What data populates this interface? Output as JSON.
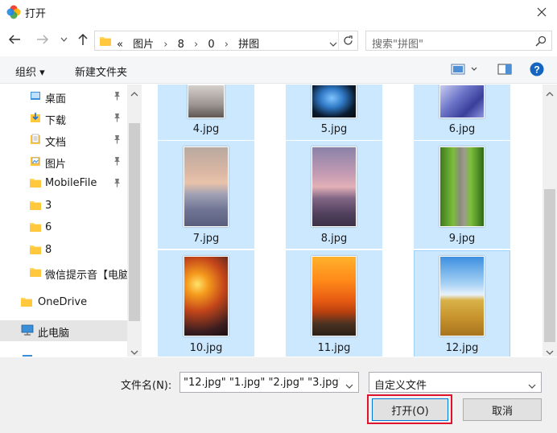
{
  "window": {
    "title": "打开",
    "colors": {
      "selection": "#cce8ff",
      "accent": "#0078d7",
      "highlight_box": "#e0132e"
    }
  },
  "address": {
    "crumbs": [
      "«",
      "图片",
      "8",
      "0",
      "拼图"
    ],
    "separator": "›"
  },
  "search": {
    "placeholder": "搜索\"拼图\""
  },
  "toolbar": {
    "organize": "组织 ▾",
    "new_folder": "新建文件夹"
  },
  "sidebar": {
    "items": [
      {
        "label": "桌面",
        "icon": "desktop-folder-icon",
        "pinned": true
      },
      {
        "label": "下载",
        "icon": "download-folder-icon",
        "pinned": true
      },
      {
        "label": "文档",
        "icon": "documents-folder-icon",
        "pinned": true
      },
      {
        "label": "图片",
        "icon": "pictures-folder-icon",
        "pinned": true
      },
      {
        "label": "MobileFile",
        "icon": "folder-icon",
        "pinned": true
      },
      {
        "label": "3",
        "icon": "folder-icon",
        "pinned": false
      },
      {
        "label": "6",
        "icon": "folder-icon",
        "pinned": false
      },
      {
        "label": "8",
        "icon": "folder-icon",
        "pinned": false
      },
      {
        "label": "微信提示音【电脑",
        "icon": "folder-icon",
        "pinned": false
      },
      {
        "label": "OneDrive",
        "icon": "onedrive-folder-icon",
        "pinned": false
      },
      {
        "label": "此电脑",
        "icon": "computer-icon",
        "pinned": false
      },
      {
        "label": "网络",
        "icon": "network-icon",
        "pinned": false
      }
    ]
  },
  "files": [
    {
      "name": "4.jpg",
      "theme": "grey-sky"
    },
    {
      "name": "5.jpg",
      "theme": "blue-butterfly"
    },
    {
      "name": "6.jpg",
      "theme": "blue-water"
    },
    {
      "name": "7.jpg",
      "theme": "pier-sunset"
    },
    {
      "name": "8.jpg",
      "theme": "pink-sea"
    },
    {
      "name": "9.jpg",
      "theme": "green-path"
    },
    {
      "name": "10.jpg",
      "theme": "feather-sunset"
    },
    {
      "name": "11.jpg",
      "theme": "orange-tree-sunset"
    },
    {
      "name": "12.jpg",
      "theme": "wheat-field"
    }
  ],
  "bottom": {
    "filename_label": "文件名(N):",
    "filename_value": "\"12.jpg\" \"1.jpg\" \"2.jpg\" \"3.jpg\"",
    "filter_value": "自定义文件",
    "open_button": "打开(O)",
    "cancel_button": "取消"
  }
}
